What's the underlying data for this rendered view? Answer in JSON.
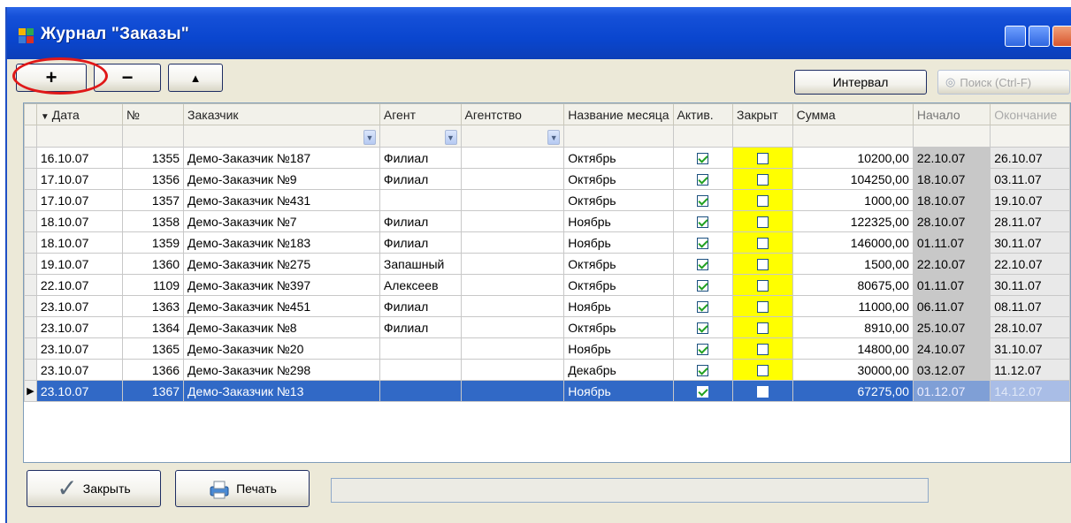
{
  "window": {
    "title": "Журнал \"Заказы\""
  },
  "toolbar": {
    "add_label": "+",
    "remove_label": "−",
    "up_label": "▲",
    "interval_label": "Интервал",
    "search_label": "Поиск (Ctrl-F)"
  },
  "columns": [
    "Дата",
    "№",
    "Заказчик",
    "Агент",
    "Агентство",
    "Название месяца",
    "Актив.",
    "Закрыт",
    "Сумма",
    "Начало",
    "Окончание"
  ],
  "rows": [
    {
      "date": "16.10.07",
      "no": "1355",
      "customer": "Демо-Заказчик №187",
      "agent": "Филиал",
      "agency": "",
      "month": "Октябрь",
      "active": true,
      "closed": false,
      "sum": "10200,00",
      "start": "22.10.07",
      "end": "26.10.07"
    },
    {
      "date": "17.10.07",
      "no": "1356",
      "customer": "Демо-Заказчик №9",
      "agent": "Филиал",
      "agency": "",
      "month": "Октябрь",
      "active": true,
      "closed": false,
      "sum": "104250,00",
      "start": "18.10.07",
      "end": "03.11.07"
    },
    {
      "date": "17.10.07",
      "no": "1357",
      "customer": "Демо-Заказчик №431",
      "agent": "",
      "agency": "",
      "month": "Октябрь",
      "active": true,
      "closed": false,
      "sum": "1000,00",
      "start": "18.10.07",
      "end": "19.10.07"
    },
    {
      "date": "18.10.07",
      "no": "1358",
      "customer": "Демо-Заказчик №7",
      "agent": "Филиал",
      "agency": "",
      "month": "Ноябрь",
      "active": true,
      "closed": false,
      "sum": "122325,00",
      "start": "28.10.07",
      "end": "28.11.07"
    },
    {
      "date": "18.10.07",
      "no": "1359",
      "customer": "Демо-Заказчик №183",
      "agent": "Филиал",
      "agency": "",
      "month": "Ноябрь",
      "active": true,
      "closed": false,
      "sum": "146000,00",
      "start": "01.11.07",
      "end": "30.11.07"
    },
    {
      "date": "19.10.07",
      "no": "1360",
      "customer": "Демо-Заказчик №275",
      "agent": "Запашный",
      "agency": "",
      "month": "Октябрь",
      "active": true,
      "closed": false,
      "sum": "1500,00",
      "start": "22.10.07",
      "end": "22.10.07"
    },
    {
      "date": "22.10.07",
      "no": "1109",
      "customer": "Демо-Заказчик №397",
      "agent": "Алексеев",
      "agency": "",
      "month": "Октябрь",
      "active": true,
      "closed": false,
      "sum": "80675,00",
      "start": "01.11.07",
      "end": "30.11.07"
    },
    {
      "date": "23.10.07",
      "no": "1363",
      "customer": "Демо-Заказчик №451",
      "agent": "Филиал",
      "agency": "",
      "month": "Ноябрь",
      "active": true,
      "closed": false,
      "sum": "11000,00",
      "start": "06.11.07",
      "end": "08.11.07"
    },
    {
      "date": "23.10.07",
      "no": "1364",
      "customer": "Демо-Заказчик №8",
      "agent": "Филиал",
      "agency": "",
      "month": "Октябрь",
      "active": true,
      "closed": false,
      "sum": "8910,00",
      "start": "25.10.07",
      "end": "28.10.07"
    },
    {
      "date": "23.10.07",
      "no": "1365",
      "customer": "Демо-Заказчик №20",
      "agent": "",
      "agency": "",
      "month": "Ноябрь",
      "active": true,
      "closed": false,
      "sum": "14800,00",
      "start": "24.10.07",
      "end": "31.10.07"
    },
    {
      "date": "23.10.07",
      "no": "1366",
      "customer": "Демо-Заказчик №298",
      "agent": "",
      "agency": "",
      "month": "Декабрь",
      "active": true,
      "closed": false,
      "sum": "30000,00",
      "start": "03.12.07",
      "end": "11.12.07"
    },
    {
      "date": "23.10.07",
      "no": "1367",
      "customer": "Демо-Заказчик №13",
      "agent": "",
      "agency": "",
      "month": "Ноябрь",
      "active": true,
      "closed": false,
      "sum": "67275,00",
      "start": "01.12.07",
      "end": "14.12.07",
      "selected": true
    }
  ],
  "footer": {
    "close_label": "Закрыть",
    "print_label": "Печать",
    "status_text": ""
  },
  "colors": {
    "titlebar": "#0a46cf",
    "closed_column": "#ffff00",
    "selection": "#3169c6",
    "highlight_ring": "#e01818"
  },
  "icons": [
    "app-icon",
    "binoculars-icon",
    "checkmark-icon",
    "printer-icon",
    "row-pointer-icon",
    "sort-arrow-icon",
    "dropdown-icon"
  ]
}
